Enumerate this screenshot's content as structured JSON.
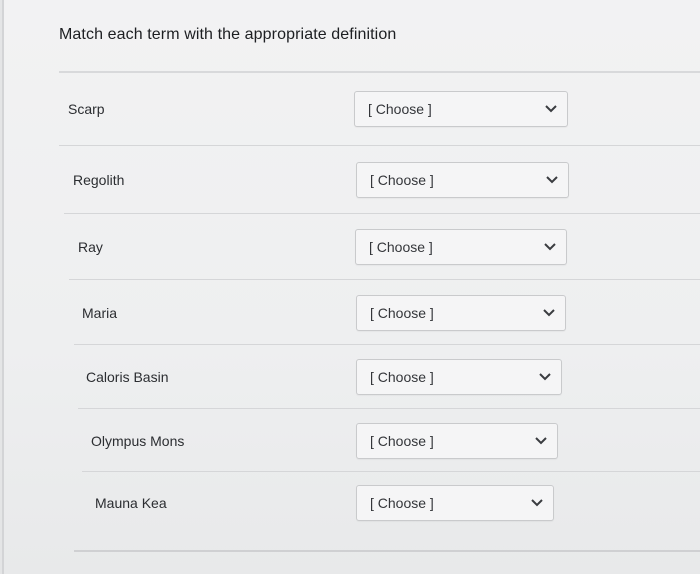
{
  "question": {
    "title": "Match each term with the appropriate definition"
  },
  "items": [
    {
      "term": "Scarp",
      "selected": "[ Choose ]"
    },
    {
      "term": "Regolith",
      "selected": "[ Choose ]"
    },
    {
      "term": "Ray",
      "selected": "[ Choose ]"
    },
    {
      "term": "Maria",
      "selected": "[ Choose ]"
    },
    {
      "term": "Caloris Basin",
      "selected": "[ Choose ]"
    },
    {
      "term": "Olympus Mons",
      "selected": "[ Choose ]"
    },
    {
      "term": "Mauna Kea",
      "selected": "[ Choose ]"
    }
  ]
}
